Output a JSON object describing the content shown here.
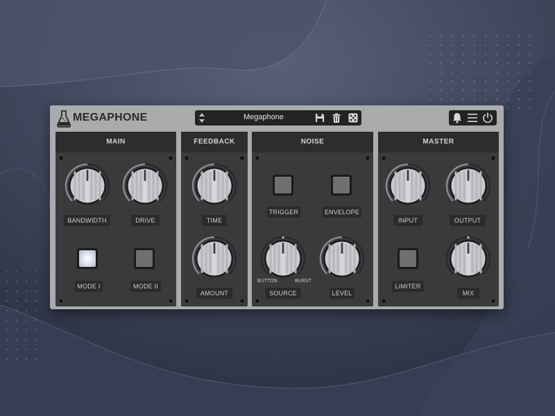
{
  "header": {
    "brand": "MEGAPHONE",
    "preset_name": "Megaphone"
  },
  "icons": {
    "logo": "flask-icon",
    "preset_arrows": "up-down-arrows-icon",
    "save": "floppy-disk-icon",
    "delete": "trash-icon",
    "random": "dice-icon",
    "notify": "bell-icon",
    "menu": "hamburger-menu-icon",
    "power": "power-icon"
  },
  "panels": {
    "main": {
      "title": "MAIN",
      "bandwidth_label": "BANDWIDTH",
      "drive_label": "DRIVE",
      "mode1_label": "MODE I",
      "mode2_label": "MODE II",
      "mode1_active": true,
      "mode2_active": false
    },
    "feedback": {
      "title": "FEEDBACK",
      "time_label": "TIME",
      "amount_label": "AMOUNT"
    },
    "noise": {
      "title": "NOISE",
      "trigger_label": "TRIGGER",
      "envelope_label": "ENVELOPE",
      "source_label": "SOURCE",
      "source_min": "BUTTON",
      "source_max": "BURST",
      "level_label": "LEVEL"
    },
    "master": {
      "title": "MASTER",
      "input_label": "INPUT",
      "output_label": "OUTPUT",
      "limiter_label": "LIMITER",
      "mix_label": "MIX"
    }
  },
  "colors": {
    "panel_bg": "#3a3a3c",
    "header_bg": "#a9abad",
    "knob_face": "#c9cbce",
    "arc": "#8b8c8f",
    "page_bg": "#2f3447"
  }
}
